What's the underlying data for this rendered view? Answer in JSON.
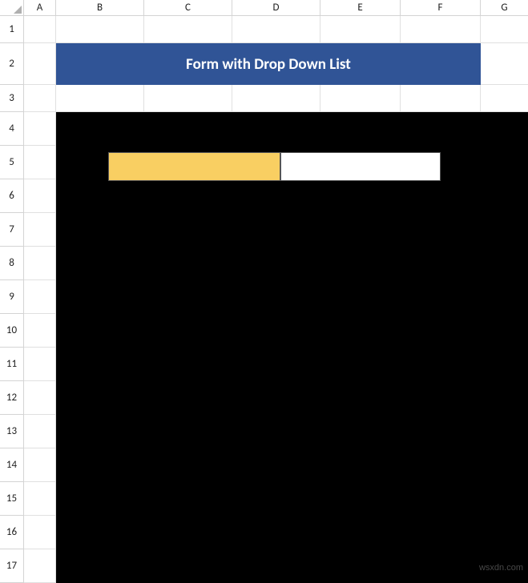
{
  "columns": [
    "A",
    "B",
    "C",
    "D",
    "E",
    "F",
    "G"
  ],
  "rows": [
    "1",
    "2",
    "3",
    "4",
    "5",
    "6",
    "7",
    "8",
    "9",
    "10",
    "11",
    "12",
    "13",
    "14",
    "15",
    "16",
    "17"
  ],
  "title": "Form with Drop Down List",
  "form": {
    "label_cell": "",
    "input_cell": ""
  },
  "watermark": "wsxdn.com"
}
